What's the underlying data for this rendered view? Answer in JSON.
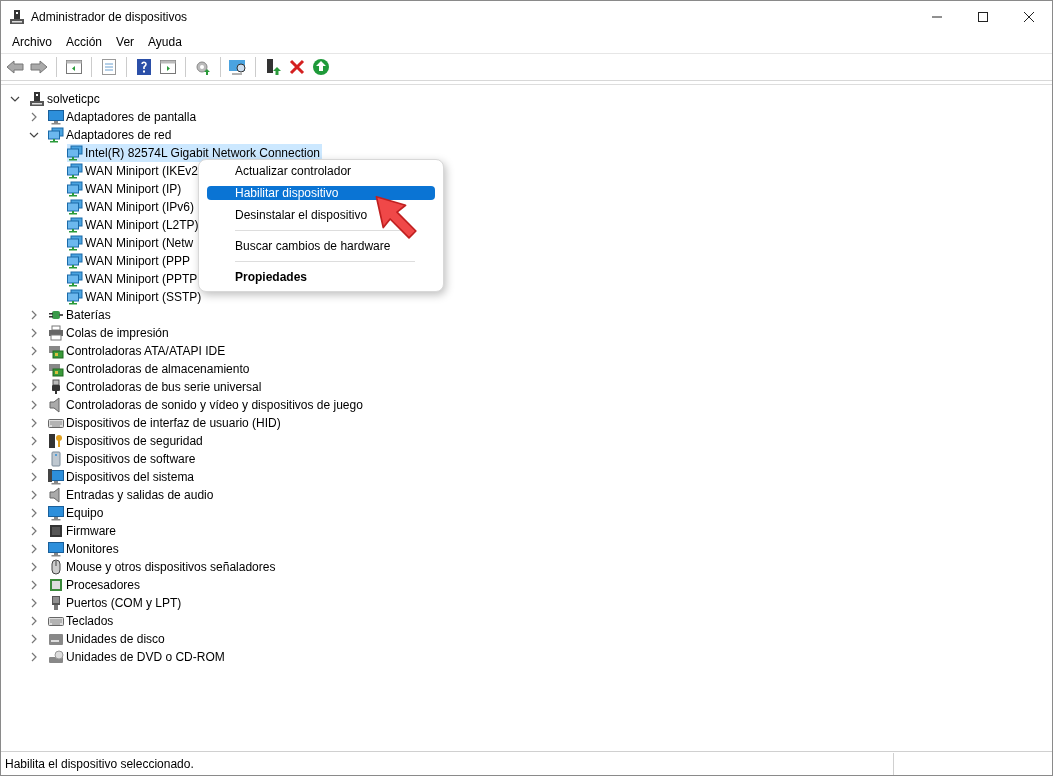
{
  "window": {
    "title": "Administrador de dispositivos"
  },
  "menu_bar": [
    "Archivo",
    "Acción",
    "Ver",
    "Ayuda"
  ],
  "tree": {
    "label": "solveticpc",
    "expanded": true,
    "selected": false,
    "children": [
      {
        "label": "Adaptadores de pantalla",
        "expanded": false,
        "selected": false
      },
      {
        "label": "Adaptadores de red",
        "expanded": true,
        "selected": false,
        "children": [
          {
            "label": "Intel(R) 82574L Gigabit Network Connection",
            "selected": true
          },
          {
            "label": "WAN Miniport (IKEv2",
            "selected": false
          },
          {
            "label": "WAN Miniport (IP)",
            "selected": false
          },
          {
            "label": "WAN Miniport (IPv6)",
            "selected": false
          },
          {
            "label": "WAN Miniport (L2TP)",
            "selected": false
          },
          {
            "label": "WAN Miniport (Netw",
            "selected": false
          },
          {
            "label": "WAN Miniport (PPP",
            "selected": false
          },
          {
            "label": "WAN Miniport (PPTP",
            "selected": false
          },
          {
            "label": "WAN Miniport (SSTP)",
            "selected": false
          }
        ]
      },
      {
        "label": "Baterías",
        "expanded": false,
        "selected": false
      },
      {
        "label": "Colas de impresión",
        "expanded": false,
        "selected": false
      },
      {
        "label": "Controladoras ATA/ATAPI IDE",
        "expanded": false,
        "selected": false
      },
      {
        "label": "Controladoras de almacenamiento",
        "expanded": false,
        "selected": false
      },
      {
        "label": "Controladoras de bus serie universal",
        "expanded": false,
        "selected": false
      },
      {
        "label": "Controladoras de sonido y vídeo y dispositivos de juego",
        "expanded": false,
        "selected": false
      },
      {
        "label": "Dispositivos de interfaz de usuario (HID)",
        "expanded": false,
        "selected": false
      },
      {
        "label": "Dispositivos de seguridad",
        "expanded": false,
        "selected": false
      },
      {
        "label": "Dispositivos de software",
        "expanded": false,
        "selected": false
      },
      {
        "label": "Dispositivos del sistema",
        "expanded": false,
        "selected": false
      },
      {
        "label": "Entradas y salidas de audio",
        "expanded": false,
        "selected": false
      },
      {
        "label": "Equipo",
        "expanded": false,
        "selected": false
      },
      {
        "label": "Firmware",
        "expanded": false,
        "selected": false
      },
      {
        "label": "Monitores",
        "expanded": false,
        "selected": false
      },
      {
        "label": "Mouse y otros dispositivos señaladores",
        "expanded": false,
        "selected": false
      },
      {
        "label": "Procesadores",
        "expanded": false,
        "selected": false
      },
      {
        "label": "Puertos (COM y LPT)",
        "expanded": false,
        "selected": false
      },
      {
        "label": "Teclados",
        "expanded": false,
        "selected": false
      },
      {
        "label": "Unidades de disco",
        "expanded": false,
        "selected": false
      },
      {
        "label": "Unidades de DVD o CD-ROM",
        "expanded": false,
        "selected": false
      }
    ]
  },
  "context_menu": [
    {
      "kind": "item",
      "label": "Actualizar controlador",
      "selected": false,
      "default": false
    },
    {
      "kind": "item",
      "label": "Habilitar dispositivo",
      "selected": true,
      "default": false
    },
    {
      "kind": "item",
      "label": "Desinstalar el dispositivo",
      "selected": false,
      "default": false
    },
    {
      "kind": "separator"
    },
    {
      "kind": "item",
      "label": "Buscar cambios de hardware",
      "selected": false,
      "default": false
    },
    {
      "kind": "separator"
    },
    {
      "kind": "item",
      "label": "Propiedades",
      "selected": false,
      "default": true
    }
  ],
  "status_bar": {
    "text": "Habilita el dispositivo seleccionado."
  }
}
